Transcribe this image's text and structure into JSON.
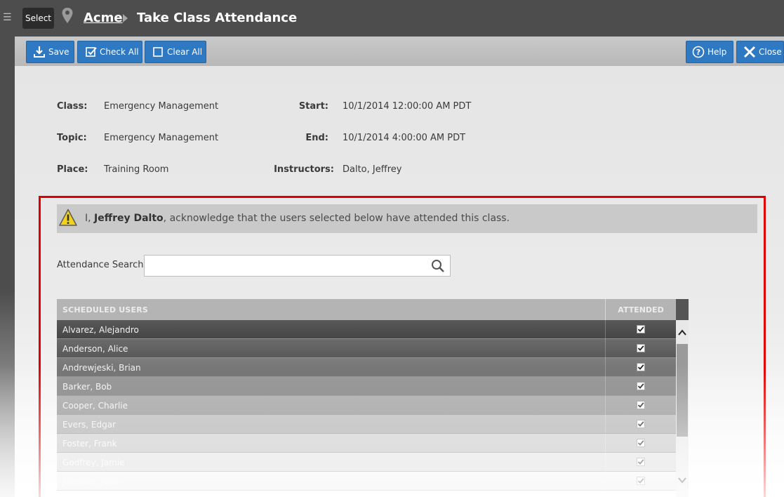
{
  "header": {
    "select_label": "Select",
    "breadcrumb_root": "Acme",
    "breadcrumb_current": "Take Class Attendance",
    "icons": {
      "menu": "hamburger-icon",
      "location": "map-pin-icon",
      "separator": "chevron-right-icon"
    }
  },
  "toolbar": {
    "save_label": "Save",
    "check_all_label": "Check All",
    "clear_all_label": "Clear All",
    "help_label": "Help",
    "close_label": "Close",
    "button_color": "#2f78c2"
  },
  "class_info": {
    "class_label": "Class:",
    "class_value": "Emergency Management",
    "topic_label": "Topic:",
    "topic_value": "Emergency Management",
    "place_label": "Place:",
    "place_value": "Training Room",
    "start_label": "Start:",
    "start_value": "10/1/2014 12:00:00 AM PDT",
    "end_label": "End:",
    "end_value": "10/1/2014 4:00:00 AM PDT",
    "instructors_label": "Instructors:",
    "instructors_value": "Dalto, Jeffrey"
  },
  "acknowledgement": {
    "prefix": "I,",
    "name": "Jeffrey Dalto",
    "suffix": ", acknowledge that the users selected below have attended this class.",
    "icon": "warning-icon",
    "frame_color": "#e00000"
  },
  "search": {
    "label": "Attendance Search:",
    "value": "",
    "placeholder": ""
  },
  "grid": {
    "col_users": "SCHEDULED USERS",
    "col_attended": "ATTENDED",
    "rows": [
      {
        "name": "Alvarez, Alejandro",
        "attended": true
      },
      {
        "name": "Anderson, Alice",
        "attended": true
      },
      {
        "name": "Andrewjeski, Brian",
        "attended": true
      },
      {
        "name": "Barker, Bob",
        "attended": true
      },
      {
        "name": "Cooper, Charlie",
        "attended": true
      },
      {
        "name": "Evers, Edgar",
        "attended": true
      },
      {
        "name": "Foster, Frank",
        "attended": true
      },
      {
        "name": "Godfrey, Jamie",
        "attended": true
      },
      {
        "name": "Johnson, Julie",
        "attended": true
      }
    ]
  }
}
